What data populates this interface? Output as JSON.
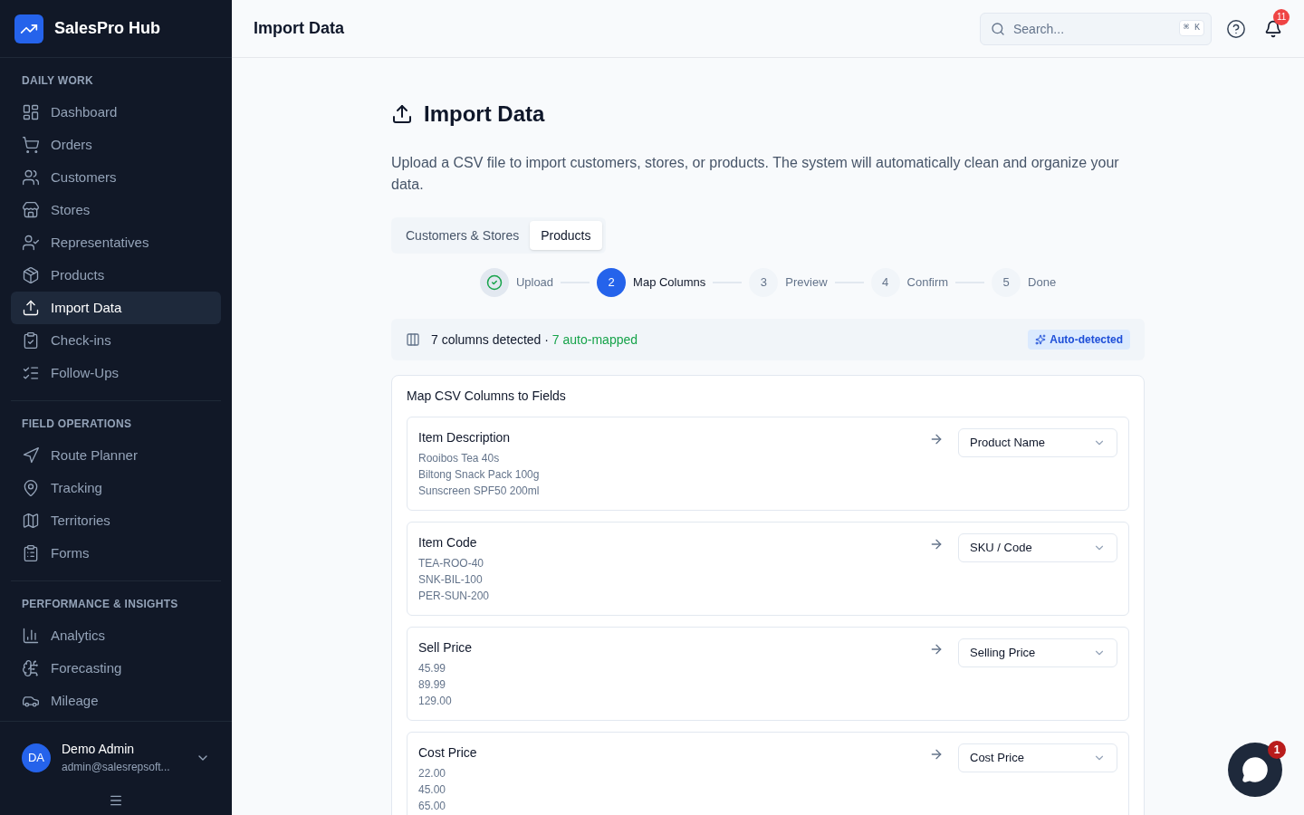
{
  "brand": {
    "name": "SalesPro Hub"
  },
  "sidebar": {
    "sections": [
      {
        "title": "DAILY WORK",
        "items": [
          {
            "label": "Dashboard",
            "selected": false
          },
          {
            "label": "Orders",
            "selected": false
          },
          {
            "label": "Customers",
            "selected": false
          },
          {
            "label": "Stores",
            "selected": false
          },
          {
            "label": "Representatives",
            "selected": false
          },
          {
            "label": "Products",
            "selected": false
          },
          {
            "label": "Import Data",
            "selected": true
          },
          {
            "label": "Check-ins",
            "selected": false
          },
          {
            "label": "Follow-Ups",
            "selected": false
          }
        ]
      },
      {
        "title": "FIELD OPERATIONS",
        "items": [
          {
            "label": "Route Planner",
            "selected": false
          },
          {
            "label": "Tracking",
            "selected": false
          },
          {
            "label": "Territories",
            "selected": false
          },
          {
            "label": "Forms",
            "selected": false
          }
        ]
      },
      {
        "title": "PERFORMANCE & INSIGHTS",
        "items": [
          {
            "label": "Analytics",
            "selected": false
          },
          {
            "label": "Forecasting",
            "selected": false
          },
          {
            "label": "Mileage",
            "selected": false
          }
        ]
      }
    ]
  },
  "user": {
    "initials": "DA",
    "name": "Demo Admin",
    "email": "admin@salesrepsoft..."
  },
  "header": {
    "title": "Import Data",
    "search_placeholder": "Search...",
    "shortcut": "⌘ K",
    "notification_count": "11"
  },
  "page": {
    "title": "Import Data",
    "description": "Upload a CSV file to import customers, stores, or products. The system will automatically clean and organize your data."
  },
  "tabs": [
    {
      "label": "Customers & Stores",
      "selected": false
    },
    {
      "label": "Products",
      "selected": true
    }
  ],
  "steps": [
    {
      "label": "Upload",
      "completed": true,
      "selected": false
    },
    {
      "number": "2",
      "label": "Map Columns",
      "completed": false,
      "selected": true
    },
    {
      "number": "3",
      "label": "Preview",
      "completed": false,
      "selected": false
    },
    {
      "number": "4",
      "label": "Confirm",
      "completed": false,
      "selected": false
    },
    {
      "number": "5",
      "label": "Done",
      "completed": false,
      "selected": false
    }
  ],
  "summary": {
    "detected": "7 columns detected",
    "separator": "·",
    "auto_mapped": "7 auto-mapped",
    "badge": "Auto-detected"
  },
  "mapping": {
    "title": "Map CSV Columns to Fields",
    "rows": [
      {
        "column": "Item Description",
        "samples": [
          "Rooibos Tea 40s",
          "Biltong Snack Pack 100g",
          "Sunscreen SPF50 200ml"
        ],
        "field": "Product Name"
      },
      {
        "column": "Item Code",
        "samples": [
          "TEA-ROO-40",
          "SNK-BIL-100",
          "PER-SUN-200"
        ],
        "field": "SKU / Code"
      },
      {
        "column": "Sell Price",
        "samples": [
          "45.99",
          "89.99",
          "129.00"
        ],
        "field": "Selling Price"
      },
      {
        "column": "Cost Price",
        "samples": [
          "22.00",
          "45.00",
          "65.00"
        ],
        "field": "Cost Price"
      }
    ]
  },
  "chat": {
    "unread": "1"
  }
}
